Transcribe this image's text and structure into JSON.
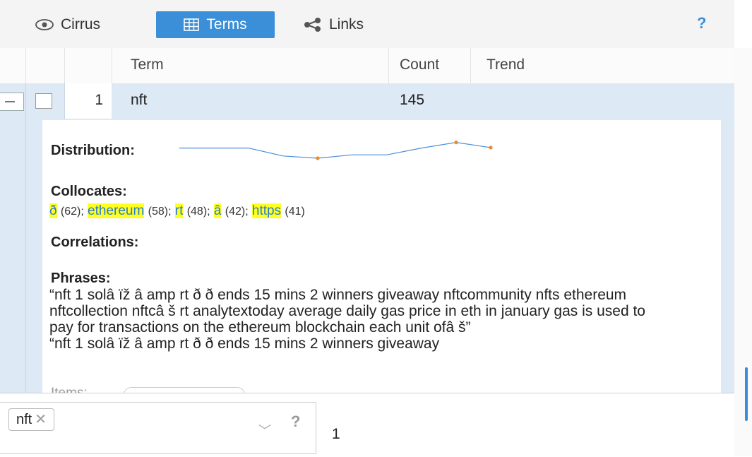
{
  "toolbar": {
    "tabs": [
      {
        "label": "Cirrus",
        "icon": "eye-icon"
      },
      {
        "label": "Terms",
        "icon": "table-icon",
        "active": true
      },
      {
        "label": "Links",
        "icon": "share-nodes-icon"
      }
    ],
    "help": "?"
  },
  "grid": {
    "columns": [
      "Term",
      "Count",
      "Trend"
    ],
    "rows": [
      {
        "index": "1",
        "term": "nft",
        "count": "145"
      }
    ]
  },
  "details": {
    "distribution_label": "Distribution:",
    "distribution_values": [
      0.7,
      0.7,
      0.7,
      0.35,
      0.25,
      0.4,
      0.4,
      0.7,
      0.95,
      0.72
    ],
    "collocates_label": "Collocates:",
    "collocates": [
      {
        "term": "ð",
        "count": "(62)"
      },
      {
        "term": "ethereum",
        "count": "(58)"
      },
      {
        "term": "rt",
        "count": "(48)"
      },
      {
        "term": "â",
        "count": "(42)"
      },
      {
        "term": "https",
        "count": "(41)"
      }
    ],
    "correlations_label": "Correlations:",
    "phrases_label": "Phrases:",
    "phrases_text": "“nft 1 solâ ïž â amp rt ð ð ends 15 mins 2 winners giveaway nftcommunity nfts ethereum nftcollection nftcâ š rt analytextoday average daily gas price in eth in january gas is used to pay for transactions on the ethereum blockchain each unit ofâ š”",
    "phrases_text_2": "“nft 1 solâ ïž â amp rt ð ð ends 15 mins 2 winners giveaway",
    "items_label": "Items:"
  },
  "bottom": {
    "tag": "nft",
    "help": "?",
    "value": "1"
  },
  "colors": {
    "accent": "#3b8ed8",
    "highlight": "#ffff22",
    "row_selected": "#dde9f4",
    "spark_line": "#4a90d9",
    "spark_dot": "#f08a1c"
  }
}
